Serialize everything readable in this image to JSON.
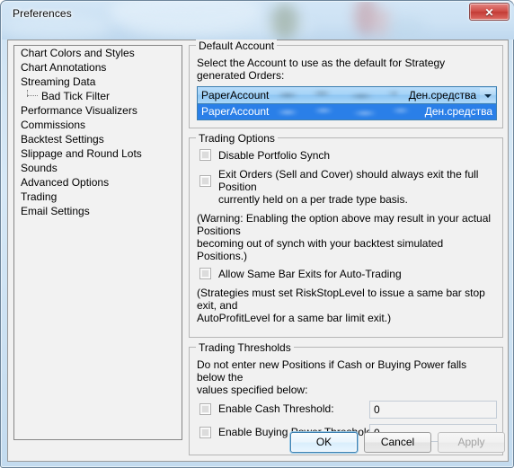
{
  "window": {
    "title": "Preferences",
    "close_label": "✕"
  },
  "sidebar": {
    "items": [
      {
        "label": "Chart Colors and Styles",
        "child": false
      },
      {
        "label": "Chart Annotations",
        "child": false
      },
      {
        "label": "Streaming Data",
        "child": false
      },
      {
        "label": "Bad Tick Filter",
        "child": true
      },
      {
        "label": "Performance Visualizers",
        "child": false
      },
      {
        "label": "Commissions",
        "child": false
      },
      {
        "label": "Backtest Settings",
        "child": false
      },
      {
        "label": "Slippage and Round Lots",
        "child": false
      },
      {
        "label": "Sounds",
        "child": false
      },
      {
        "label": "Advanced Options",
        "child": false
      },
      {
        "label": "Trading",
        "child": false
      },
      {
        "label": "Email Settings",
        "child": false
      }
    ]
  },
  "default_account": {
    "legend": "Default Account",
    "description": "Select the Account to use as the default for Strategy generated Orders:",
    "selected": {
      "name": "PaperAccount",
      "right": "Ден.средства"
    },
    "options": [
      {
        "name": "PaperAccount",
        "right": "Ден.средства"
      }
    ]
  },
  "trading_options": {
    "legend": "Trading Options",
    "disable_portfolio_synch": "Disable Portfolio Synch",
    "exit_orders_line1": "Exit Orders (Sell and Cover) should always exit the full Position",
    "exit_orders_line2": "currently held on a per trade type basis.",
    "warning_line1": "(Warning: Enabling the option above may result in your actual Positions",
    "warning_line2": "becoming out of synch with your backtest simulated Positions.)",
    "allow_same_bar_exits": "Allow Same Bar Exits for Auto-Trading",
    "strategies_note_line1": "(Strategies must set RiskStopLevel to issue a same bar stop exit, and",
    "strategies_note_line2": "AutoProfitLevel for a same bar limit exit.)"
  },
  "trading_thresholds": {
    "legend": "Trading Thresholds",
    "description_line1": "Do not enter new Positions if Cash or Buying Power falls below the",
    "description_line2": "values specified below:",
    "cash_threshold_label": "Enable Cash Threshold:",
    "cash_threshold_value": "0",
    "buying_power_label": "Enable Buying Power Threshold;",
    "buying_power_value": "0"
  },
  "buttons": {
    "ok": "OK",
    "cancel": "Cancel",
    "apply": "Apply"
  }
}
